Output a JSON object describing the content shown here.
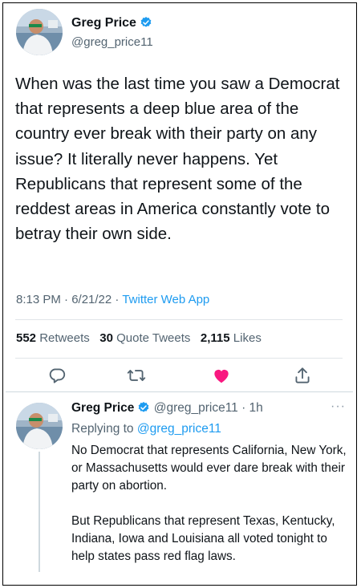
{
  "tweet": {
    "author_name": "Greg Price",
    "author_handle": "@greg_price11",
    "text": "When was the last time you saw a Democrat that represents a deep blue area of the country ever break with their party on any issue? It literally never happens. Yet Republicans that represent some of the reddest areas in America constantly vote to betray their own side.",
    "time": "8:13 PM · 6/21/22 · ",
    "app": "Twitter Web App",
    "retweets_count": "552",
    "retweets_label": "Retweets",
    "quotes_count": "30",
    "quotes_label": "Quote Tweets",
    "likes_count": "2,115",
    "likes_label": "Likes",
    "liked": true
  },
  "reply": {
    "author_name": "Greg Price",
    "handle_time": "@greg_price11 · 1h",
    "replying_prefix": "Replying to ",
    "replying_to": "@greg_price11",
    "paragraph1": "No Democrat that represents California, New York, or Massachusetts would ever dare break with their party on abortion.",
    "paragraph2": "But Republicans that represent Texas, Kentucky, Indiana, Iowa and Louisiana all voted tonight to help states pass red flag laws.",
    "more_menu": "···"
  },
  "colors": {
    "link": "#1d9bf0",
    "like": "#f91880",
    "muted": "#536471",
    "verified": "#1d9bf0"
  },
  "icons": [
    "verified-badge-icon",
    "reply-icon",
    "retweet-icon",
    "like-icon",
    "share-icon",
    "more-icon"
  ]
}
